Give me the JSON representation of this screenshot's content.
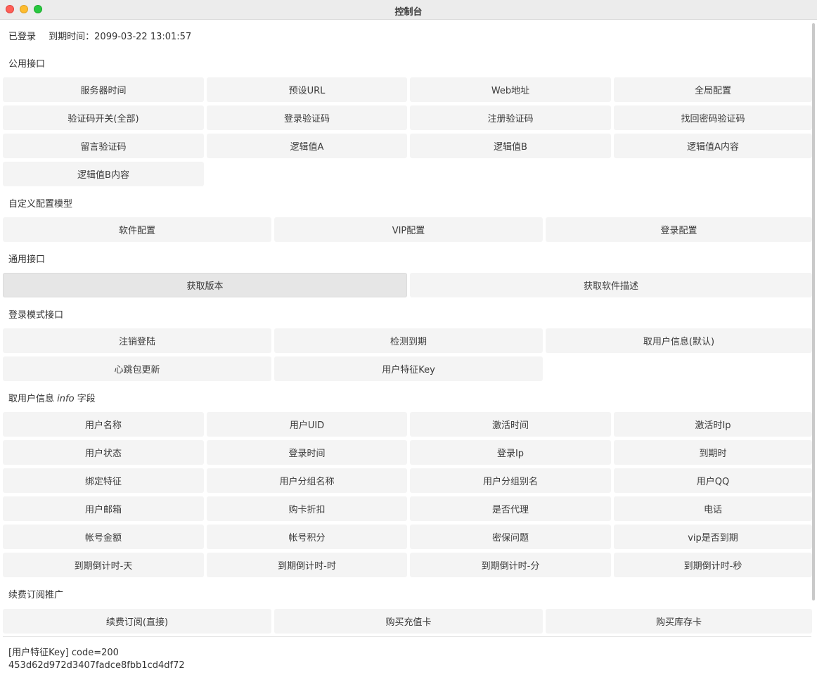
{
  "window": {
    "title": "控制台"
  },
  "status": {
    "logged_in": "已登录",
    "expiry": "到期时间：2099-03-22 13:01:57"
  },
  "sections": {
    "public": "公用接口",
    "custom": "自定义配置模型",
    "general": "通用接口",
    "login_mode": "登录模式接口",
    "info_prefix": "取用户信息",
    "info_italic": "info",
    "info_suffix": "字段",
    "renew": "续费订阅推广"
  },
  "buttons": {
    "public": [
      "服务器时间",
      "预设URL",
      "Web地址",
      "全局配置",
      "验证码开关(全部)",
      "登录验证码",
      "注册验证码",
      "找回密码验证码",
      "留言验证码",
      "逻辑值A",
      "逻辑值B",
      "逻辑值A内容",
      "逻辑值B内容"
    ],
    "custom": [
      "软件配置",
      "VIP配置",
      "登录配置"
    ],
    "general": [
      "获取版本",
      "获取软件描述"
    ],
    "login_mode": [
      "注销登陆",
      "检测到期",
      "取用户信息(默认)",
      "心跳包更新",
      "用户特征Key"
    ],
    "info": [
      "用户名称",
      "用户UID",
      "激活时间",
      "激活时Ip",
      "用户状态",
      "登录时间",
      "登录Ip",
      "到期时",
      "绑定特征",
      "用户分组名称",
      "用户分组别名",
      "用户QQ",
      "用户邮箱",
      "购卡折扣",
      "是否代理",
      "电话",
      "帐号金额",
      "帐号积分",
      "密保问题",
      "vip是否到期",
      "到期倒计时-天",
      "到期倒计时-时",
      "到期倒计时-分",
      "到期倒计时-秒"
    ],
    "renew": [
      "续费订阅(直接)",
      "购买充值卡",
      "购买库存卡"
    ]
  },
  "log": {
    "line1": "[用户特征Key] code=200",
    "line2": "453d62d972d3407fadce8fbb1cd4df72"
  }
}
